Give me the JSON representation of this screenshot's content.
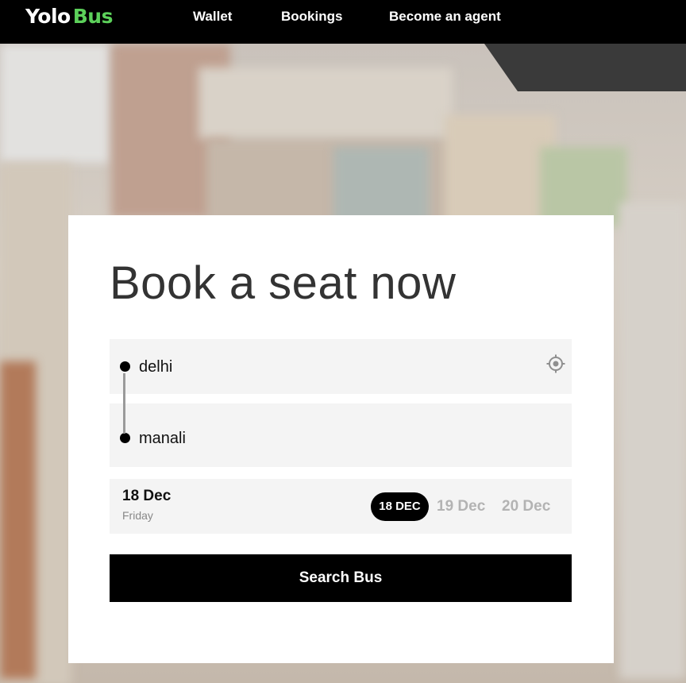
{
  "nav": {
    "logo_part1": "Yolo",
    "logo_part2": "Bus",
    "links": [
      "Wallet",
      "Bookings",
      "Become an agent"
    ]
  },
  "booking": {
    "headline": "Book a seat now",
    "from": "delhi",
    "to": "manali",
    "selected_date": "18 Dec",
    "selected_day": "Friday",
    "date_chips": [
      "18 DEC",
      "19 Dec",
      "20 Dec"
    ],
    "search_label": "Search Bus"
  },
  "colors": {
    "brand_green": "#5cd05a",
    "primary": "#000000",
    "field_bg": "#f4f4f4"
  },
  "icons": {
    "locate": "crosshair-locate-icon"
  }
}
